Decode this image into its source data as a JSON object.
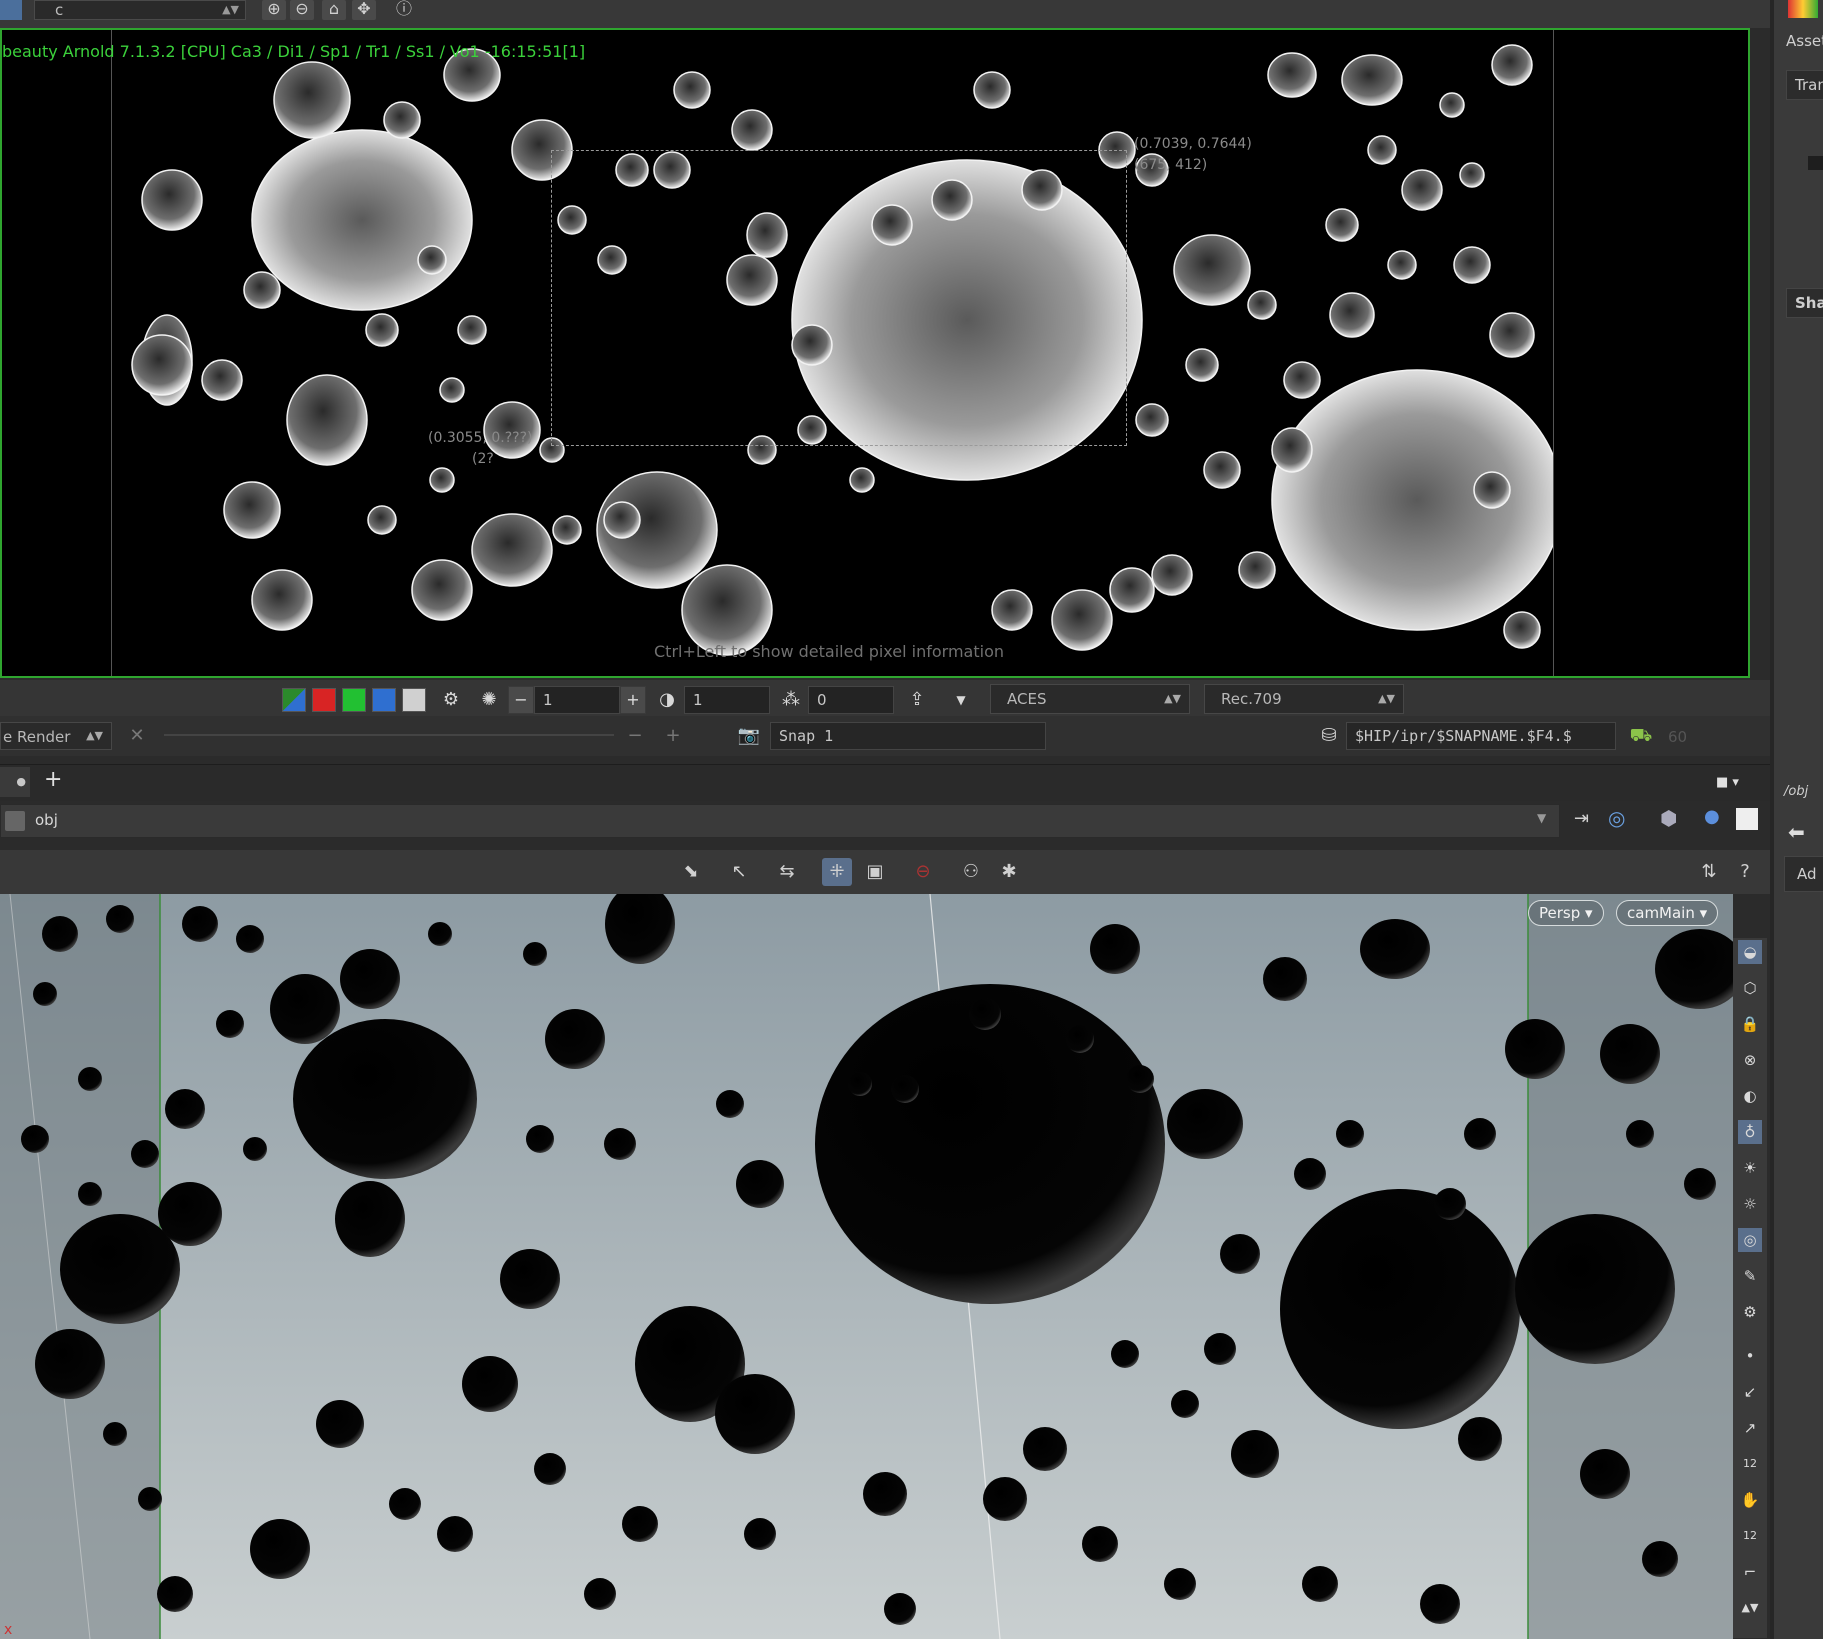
{
  "top_toolbar": {
    "aov_channel_value": "c",
    "icons": [
      "zoom-in-icon",
      "zoom-out-icon",
      "home-icon",
      "fit-icon",
      "info-icon"
    ]
  },
  "render_view": {
    "info_text": "beauty  Arnold 7.1.3.2 [CPU]  Ca3 / Di1 / Sp1 / Tr1 / Ss1 / Vo1 -16:15:51[1]",
    "region_top_uv": "(0.7039, 0.7644)",
    "region_top_px": "(675, 412)",
    "region_bottom_uv": "(0.3055, 0.???)",
    "region_bottom_px": "(2?",
    "pixel_hint": "Ctrl+Left to show detailed pixel information"
  },
  "render_controls": {
    "exposure_value": "1",
    "gamma_value": "1",
    "threads_value": "0",
    "view_transform": "ACES",
    "display": "Rec.709",
    "channel_colors": [
      "#2b8a2b",
      "#d82424",
      "#22c032",
      "#2f6fd0",
      "#d0d0d0"
    ]
  },
  "snap_bar": {
    "render_select": "e Render",
    "snap_label": "Snap 1",
    "output_path": "$HIP/ipr/$SNAPNAME.$F4.$",
    "frame_value": "60"
  },
  "network": {
    "path": "obj",
    "right_path": "/obj"
  },
  "scene_view": {
    "persp_label": "Persp",
    "camera_label": "camMain"
  },
  "params_pane": {
    "asset_label": "Asset",
    "tran_label": "Tran",
    "sha_label": "Sha",
    "ad_label": "Ad"
  },
  "right_tools": {
    "snap_number_a": "12",
    "snap_number_b": "12"
  }
}
